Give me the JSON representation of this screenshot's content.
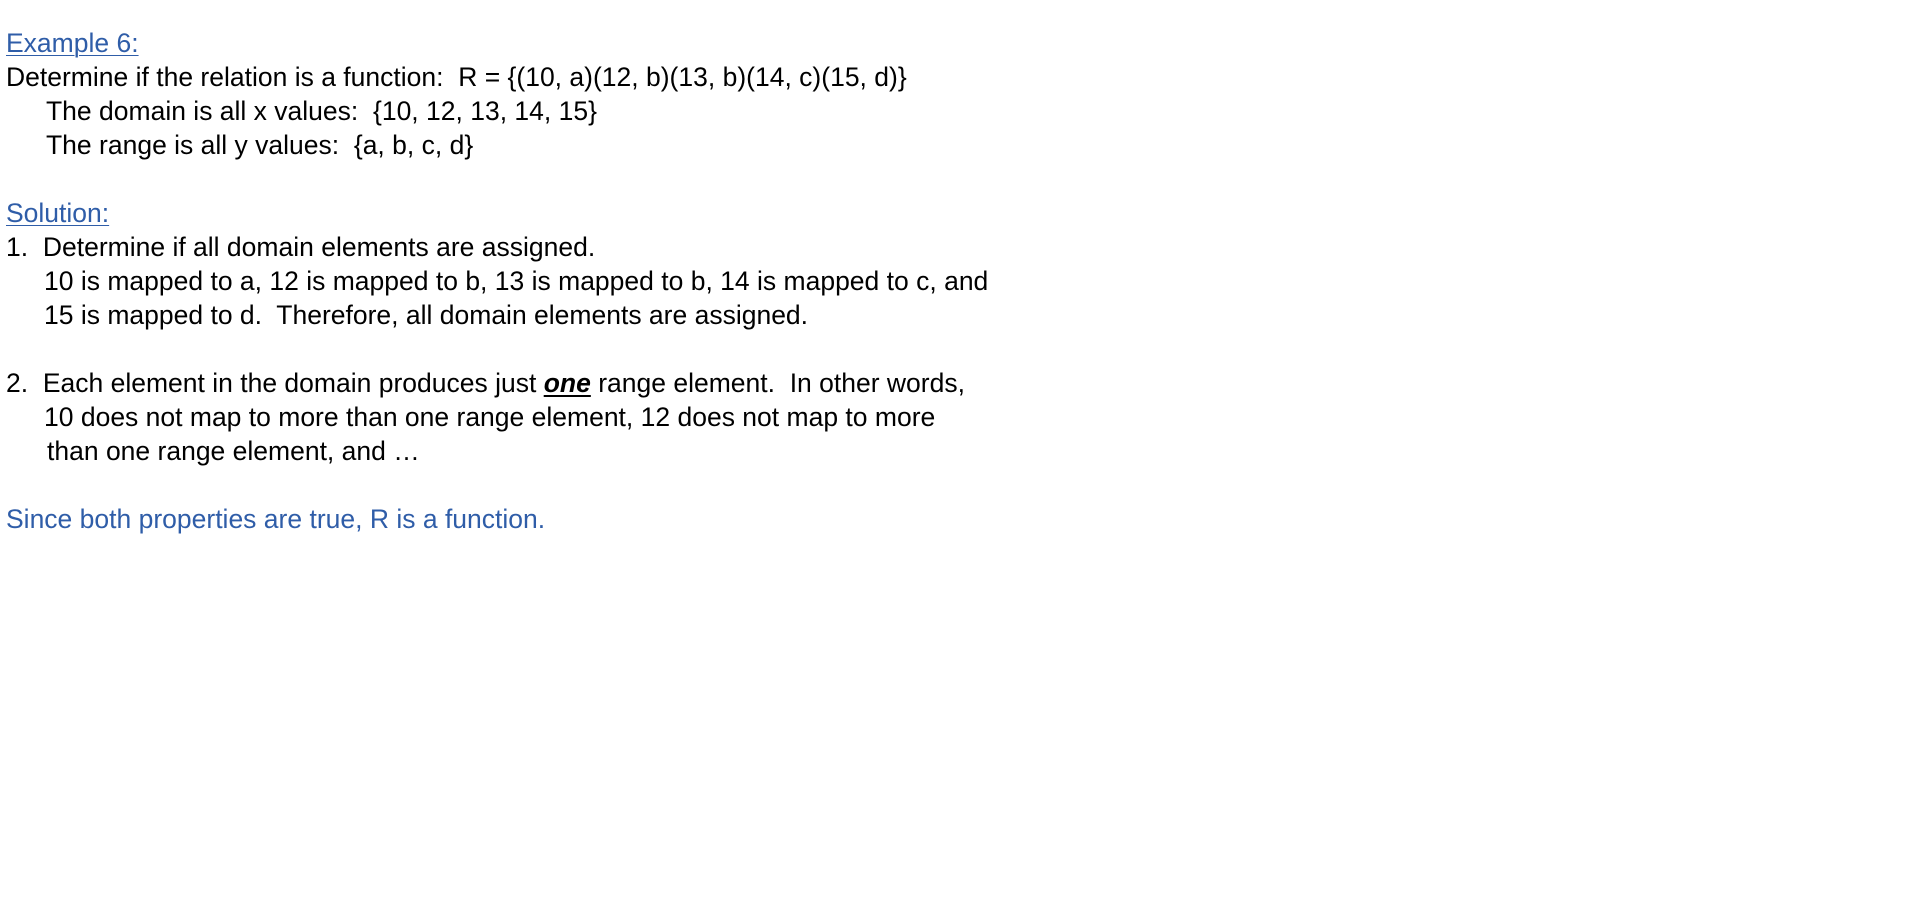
{
  "example": {
    "heading": "Example 6:",
    "prompt": "Determine if the relation is a function:  R = {(10, a)(12, b)(13, b)(14, c)(15, d)}",
    "domain_line": "The domain is all x values:  {10, 12, 13, 14, 15}",
    "range_line": "The range is all y values:  {a, b, c, d}"
  },
  "solution": {
    "heading": "Solution:",
    "step1": {
      "number": "1.",
      "title": "Determine if all domain elements are assigned.",
      "line2": "10 is mapped to a, 12 is mapped to b, 13 is mapped to b, 14 is mapped to c, and",
      "line3": "15 is mapped to d.  Therefore, all domain elements are assigned."
    },
    "step2": {
      "number": "2.",
      "text_before": "Each element in the domain produces just ",
      "emphasis": "one",
      "text_after": " range element.  In other words,",
      "line2": "10 does not map to more than one range element, 12 does not map to more",
      "line3": "than one range element, and …"
    },
    "conclusion": "Since both properties are true, R is a function."
  },
  "colors": {
    "accent_blue": "#2f5da8",
    "text": "#000000",
    "background": "#ffffff"
  }
}
